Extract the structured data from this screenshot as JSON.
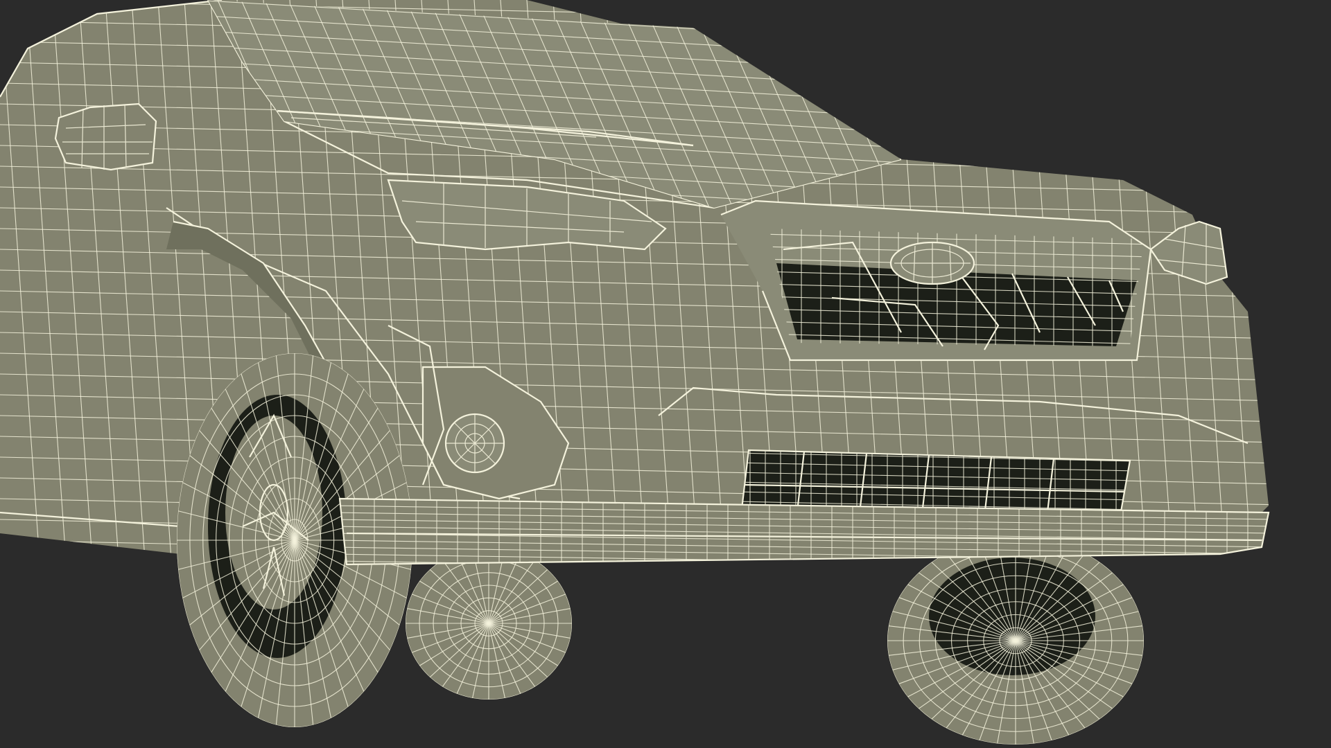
{
  "scene": {
    "subject": "wireframe-car-front-quarter",
    "background": "#2b2b2b",
    "surface": "#83836f",
    "surface_dark": "#6f705d",
    "shadow_gap": "#1c1f18",
    "wire": "#f4f2dc"
  }
}
